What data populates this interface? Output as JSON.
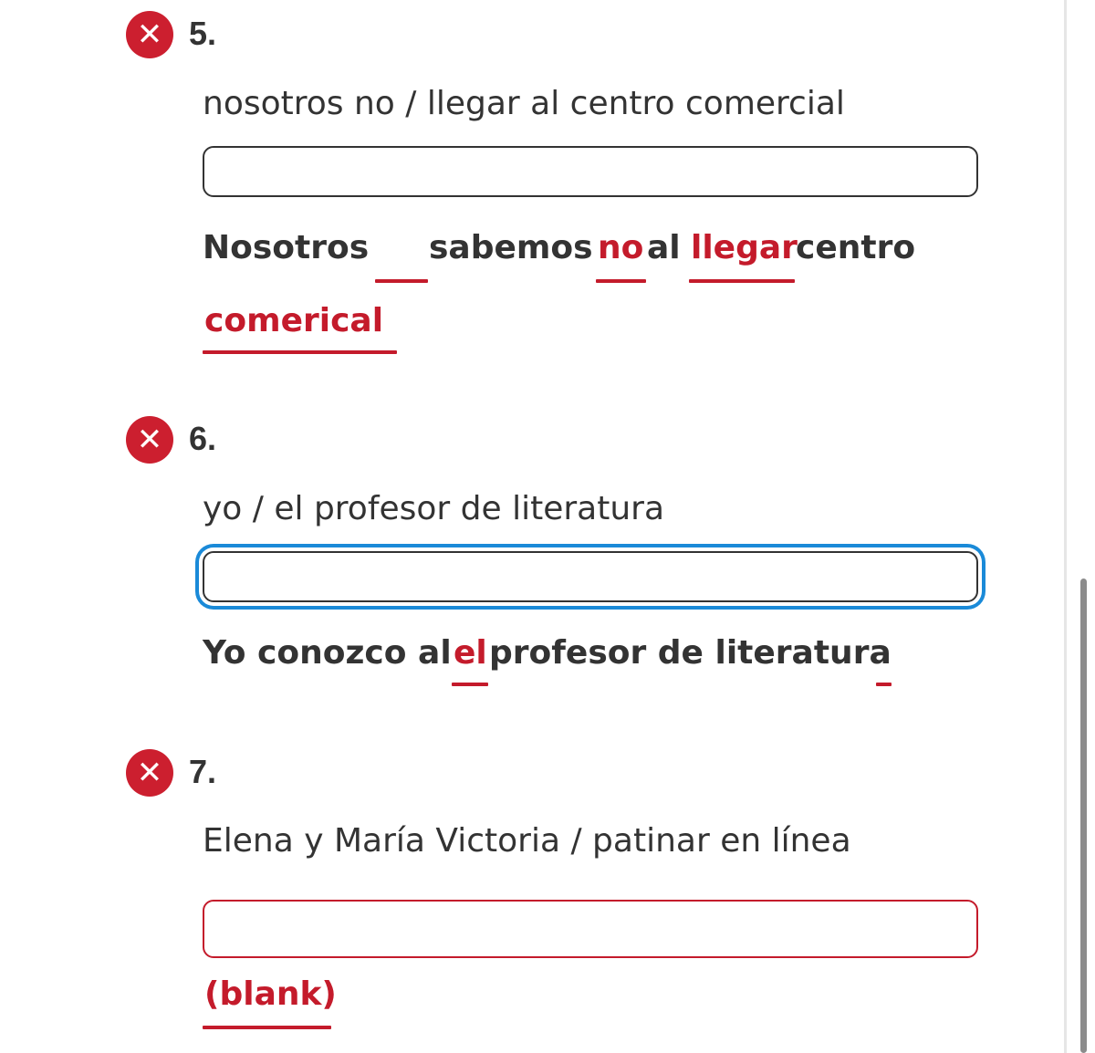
{
  "colors": {
    "error_red": "#cc1f2f",
    "focus_blue": "#1a8ad8",
    "text_dark": "#333333"
  },
  "questions": [
    {
      "number": "5.",
      "status_icon": "x-circle-icon",
      "prompt": "nosotros no / llegar al centro comercial",
      "input_value": "",
      "feedback": {
        "w1": "Nosotros",
        "w2": "sabemos",
        "w3": "no",
        "w4": "al",
        "w5": "llegar",
        "w6": "centro",
        "w7": "comerical"
      }
    },
    {
      "number": "6.",
      "status_icon": "x-circle-icon",
      "prompt": "yo / el profesor de literatura",
      "input_value": "",
      "feedback": {
        "w1": "Yo conozco al",
        "w2": "el",
        "w3": "profesor de literatura"
      }
    },
    {
      "number": "7.",
      "status_icon": "x-circle-icon",
      "prompt": "Elena y María Victoria / patinar en línea",
      "input_value": "",
      "feedback": {
        "w1": "(blank)"
      }
    }
  ]
}
